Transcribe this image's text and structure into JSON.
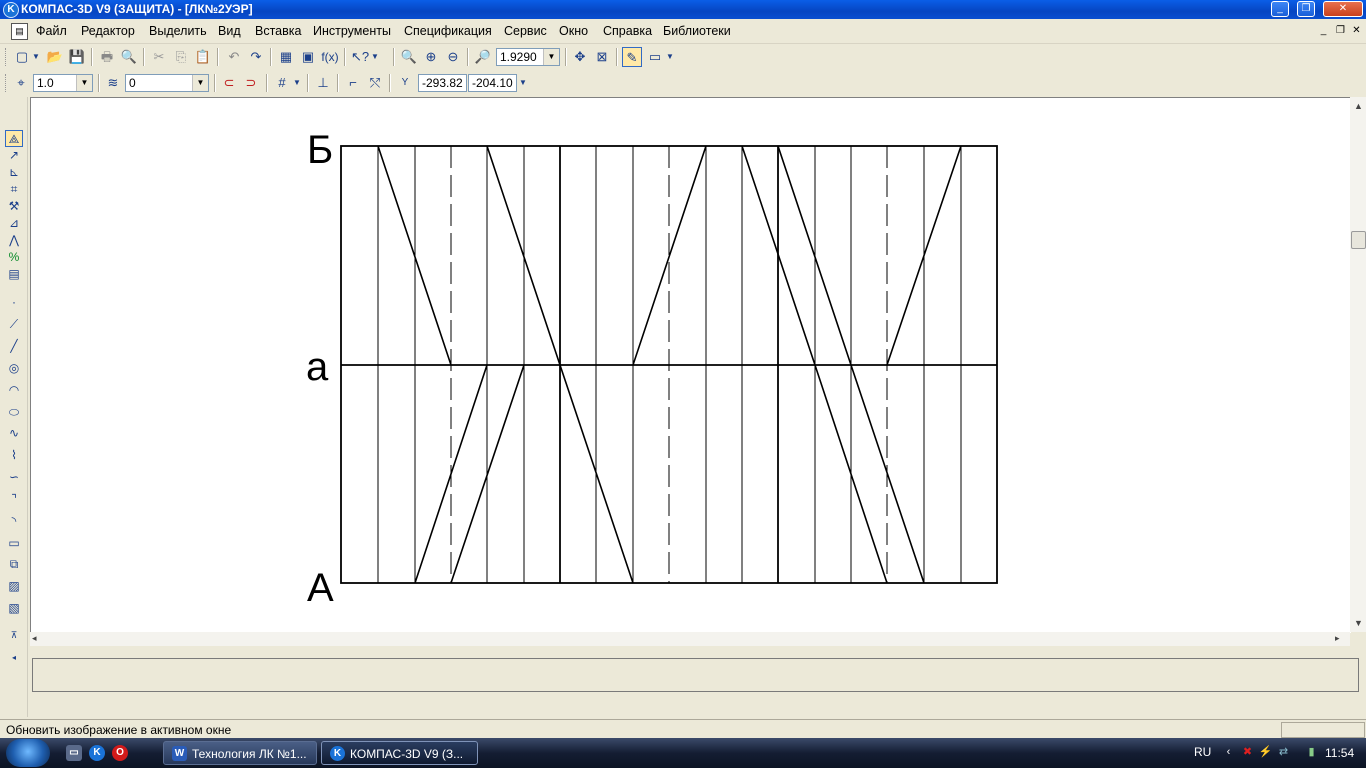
{
  "window": {
    "title": "КОМПАС-3D V9 (ЗАЩИТА) - [ЛК№2УЭР]",
    "minimize_label": "_",
    "restore_label": "❐",
    "close_label": "✕"
  },
  "menu": {
    "items": [
      "Файл",
      "Редактор",
      "Выделить",
      "Вид",
      "Вставка",
      "Инструменты",
      "Спецификация",
      "Сервис",
      "Окно",
      "Справка",
      "Библиотеки"
    ],
    "mdi_minimize": "_",
    "mdi_restore": "❐",
    "mdi_close": "✕"
  },
  "toolbar": {
    "zoom_value": "1.9290",
    "step_value": "1.0",
    "layer_value": "0",
    "coord_x": "-293.82",
    "coord_y": "-204.10",
    "coord_label": "Y"
  },
  "drawing": {
    "labels": {
      "top": "Б",
      "middle": "а",
      "bottom": "А"
    }
  },
  "status": {
    "text": "Обновить изображение в активном окне"
  },
  "taskbar": {
    "tasks": [
      {
        "label": "Технология ЛК №1..."
      },
      {
        "label": "КОМПАС-3D V9 (З..."
      }
    ],
    "language": "RU",
    "clock": "11:54"
  },
  "icons": [
    "windows-start-icon",
    "kompas-icon",
    "opera-icon",
    "word-icon"
  ]
}
